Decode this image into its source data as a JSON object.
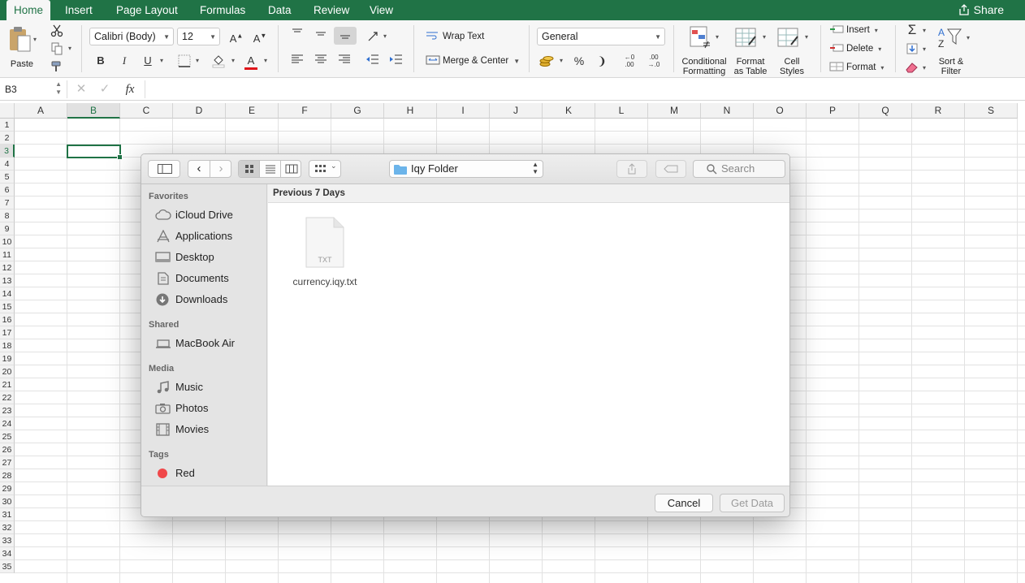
{
  "tabs": [
    {
      "label": "Home"
    },
    {
      "label": "Insert"
    },
    {
      "label": "Page Layout"
    },
    {
      "label": "Formulas"
    },
    {
      "label": "Data"
    },
    {
      "label": "Review"
    },
    {
      "label": "View"
    }
  ],
  "share_label": "Share",
  "ribbon": {
    "paste_label": "Paste",
    "font_name": "Calibri (Body)",
    "font_size": "12",
    "bold": "B",
    "italic": "I",
    "underline": "U",
    "wrap_text": "Wrap Text",
    "merge_center": "Merge & Center",
    "number_format": "General",
    "percent": "%",
    "comma": "❩",
    "inc_decimal_top": "←0",
    "inc_decimal_bot": ".00",
    "dec_decimal_top": ".00",
    "dec_decimal_bot": "→.0",
    "cond_fmt_1": "Conditional",
    "cond_fmt_2": "Formatting",
    "fmt_table_1": "Format",
    "fmt_table_2": "as Table",
    "cell_styles_1": "Cell",
    "cell_styles_2": "Styles",
    "insert": "Insert",
    "delete": "Delete",
    "format": "Format",
    "sort_1": "Sort &",
    "sort_2": "Filter"
  },
  "formula_bar": {
    "name_box": "B3",
    "fx": "fx",
    "formula": ""
  },
  "grid": {
    "columns": [
      "A",
      "B",
      "C",
      "D",
      "E",
      "F",
      "G",
      "H",
      "I",
      "J",
      "K",
      "L",
      "M",
      "N",
      "O",
      "P",
      "Q",
      "R",
      "S"
    ],
    "rows": [
      "1",
      "2",
      "3",
      "4",
      "5",
      "6",
      "7",
      "8",
      "9",
      "10",
      "11",
      "12",
      "13",
      "14",
      "15",
      "16",
      "17",
      "18",
      "19",
      "20",
      "21",
      "22",
      "23",
      "24",
      "25",
      "26",
      "27",
      "28",
      "29",
      "30",
      "31",
      "32",
      "33",
      "34",
      "35"
    ],
    "selected_column": "B",
    "selected_row": "3"
  },
  "dialog": {
    "location": "Iqy Folder",
    "search_placeholder": "Search",
    "sidebar": {
      "favorites_header": "Favorites",
      "favorites": [
        {
          "label": "iCloud Drive",
          "icon": "cloud-icon"
        },
        {
          "label": "Applications",
          "icon": "applications-icon"
        },
        {
          "label": "Desktop",
          "icon": "desktop-icon"
        },
        {
          "label": "Documents",
          "icon": "documents-icon"
        },
        {
          "label": "Downloads",
          "icon": "downloads-icon"
        }
      ],
      "shared_header": "Shared",
      "shared": [
        {
          "label": "MacBook Air",
          "icon": "laptop-icon"
        }
      ],
      "media_header": "Media",
      "media": [
        {
          "label": "Music",
          "icon": "music-icon"
        },
        {
          "label": "Photos",
          "icon": "camera-icon"
        },
        {
          "label": "Movies",
          "icon": "film-icon"
        }
      ],
      "tags_header": "Tags",
      "tags": [
        {
          "label": "Red",
          "color": "#f0484a"
        }
      ]
    },
    "section_header": "Previous 7 Days",
    "files": [
      {
        "name": "currency.iqy.txt",
        "type": "TXT"
      }
    ],
    "cancel": "Cancel",
    "get_data": "Get Data"
  }
}
